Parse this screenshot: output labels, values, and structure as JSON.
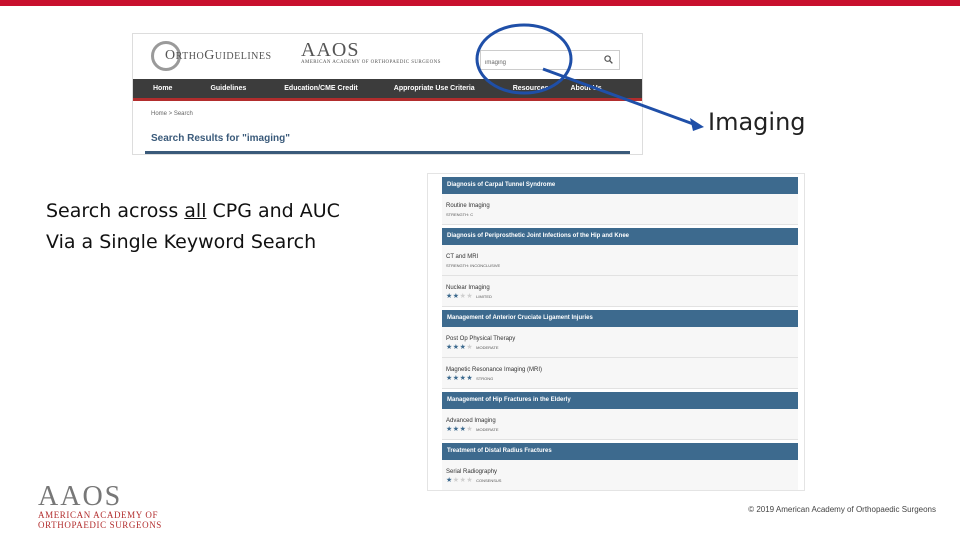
{
  "colors": {
    "accent_red": "#c8102e",
    "nav_dark": "#3c3c3c",
    "header_blue": "#3d6a8e",
    "annotation_blue": "#1f4fa8"
  },
  "site": {
    "logo_text": "OrthoGuidelines",
    "aaos_mark": "AAOS",
    "aaos_sub": "American Academy of Orthopaedic Surgeons",
    "search": {
      "value": "imaging",
      "icon": "search-icon"
    },
    "nav": [
      "Home",
      "Guidelines",
      "Education/CME Credit",
      "Appropriate Use Criteria",
      "Resources",
      "About Us"
    ],
    "breadcrumb": "Home > Search",
    "results_title": "Search Results for \"imaging\""
  },
  "annotation": {
    "label": "Imaging"
  },
  "headline": {
    "line1_pre": "Search across ",
    "line1_underlined": "all",
    "line1_post": " CPG and AUC",
    "line2": "Via a Single Keyword Search"
  },
  "results": [
    {
      "heading": "Diagnosis of Carpal Tunnel Syndrome",
      "items": [
        {
          "title": "Routine Imaging",
          "stars": 0,
          "strength": "STRENGTH: C"
        }
      ]
    },
    {
      "heading": "Diagnosis of Periprosthetic Joint Infections of the Hip and Knee",
      "items": [
        {
          "title": "CT and MRI",
          "stars": 0,
          "strength": "STRENGTH: INCONCLUSIVE"
        },
        {
          "title": "Nuclear Imaging",
          "stars": 2,
          "strength": "LIMITED"
        }
      ]
    },
    {
      "heading": "Management of Anterior Cruciate Ligament Injuries",
      "items": [
        {
          "title": "Post Op Physical Therapy",
          "stars": 3,
          "strength": "MODERATE"
        },
        {
          "title": "Magnetic Resonance Imaging (MRI)",
          "stars": 4,
          "strength": "STRONG"
        }
      ]
    },
    {
      "heading": "Management of Hip Fractures in the Elderly",
      "items": [
        {
          "title": "Advanced Imaging",
          "stars": 3,
          "strength": "MODERATE"
        }
      ]
    },
    {
      "heading": "Treatment of Distal Radius Fractures",
      "items": [
        {
          "title": "Serial Radiography",
          "stars": 1,
          "strength": "CONSENSUS"
        }
      ]
    }
  ],
  "footer": {
    "logo_mark": "AAOS",
    "logo_sub_1": "American Academy of",
    "logo_sub_2": "Orthopaedic Surgeons",
    "copyright": "© 2019 American Academy of Orthopaedic Surgeons"
  }
}
